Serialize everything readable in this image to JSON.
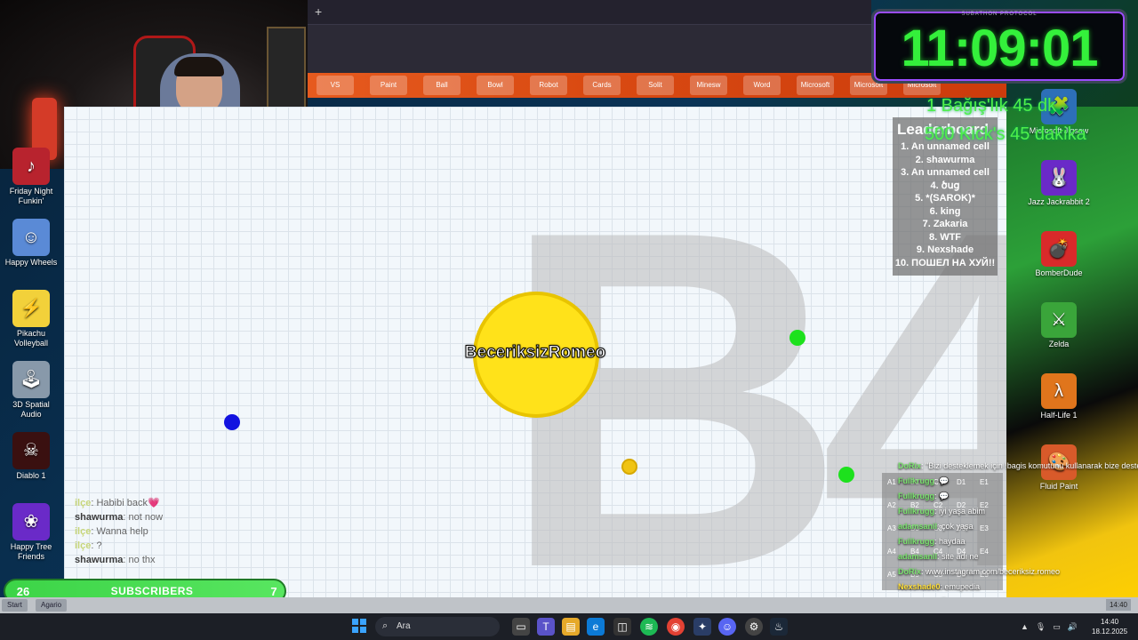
{
  "timer": {
    "header": "SUBATHON PROTOCOL",
    "time": "11:09:01",
    "sub1": "1 Bağış'lık 45 dk",
    "sub2": "500 Kick's 45 dakika"
  },
  "game": {
    "player_name": "BeceriksizRomeo",
    "background_text": "B4",
    "leaderboard": {
      "title": "Leaderboard",
      "entries": [
        "1. An unnamed cell",
        "2. shawurma",
        "3. An unnamed cell",
        "4. ծսց",
        "5. *(SAROK)*",
        "6. king",
        "7. Zakaria",
        "8. WTF",
        "9. Nexshade",
        "10. ПОШЕЛ НА ХУЙ!!"
      ]
    },
    "chat": [
      {
        "nick": "ilçe",
        "msg": ": Habibi back💗",
        "faint": true
      },
      {
        "nick": "shawurma",
        "msg": ": not now",
        "faint": false
      },
      {
        "nick": "ilçe",
        "msg": ": Wanna help",
        "faint": true
      },
      {
        "nick": "ilçe",
        "msg": ": ?",
        "faint": true
      },
      {
        "nick": "shawurma",
        "msg": ": no thx",
        "faint": false
      }
    ]
  },
  "subscribers": {
    "count": "26",
    "label": "SUBSCRIBERS",
    "goal": "7"
  },
  "desktop_icons_left": [
    {
      "label": "Friday Night Funkin'",
      "icon": "fnf-icon"
    },
    {
      "label": "Happy Wheels",
      "icon": "happy-wheels-icon"
    },
    {
      "label": "Pikachu Volleyball",
      "icon": "pikachu-icon"
    },
    {
      "label": "3D Spatial Audio",
      "icon": "joystick-icon"
    },
    {
      "label": "Diablo 1",
      "icon": "diablo-icon"
    },
    {
      "label": "Happy Tree Friends",
      "icon": "htf-icon"
    }
  ],
  "desktop_icons_right": [
    {
      "label": "Microsoft Jigsaw",
      "icon": "jigsaw-icon"
    },
    {
      "label": "Jazz Jackrabbit 2",
      "icon": "jazz-icon"
    },
    {
      "label": "BomberDude",
      "icon": "bomber-icon"
    },
    {
      "label": "Zelda",
      "icon": "zelda-icon"
    },
    {
      "label": "Half-Life 1",
      "icon": "halflife-icon"
    },
    {
      "label": "Fluid Paint",
      "icon": "fluidpaint-icon"
    }
  ],
  "strip_items": [
    "VS",
    "Paint",
    "Ball",
    "Bowl",
    "Robot",
    "Cards",
    "Solit",
    "Minesw",
    "Word",
    "Microsoft",
    "Microsoft",
    "Microsoft"
  ],
  "feed": [
    {
      "user": "DoRix",
      "msg": ": \"Bizi desteklemek için !bagis komutunu kullanarak bize destek verebilirsiniz\""
    },
    {
      "user": "Fullkrugg",
      "msg": ": 💬"
    },
    {
      "user": "Fullkrugg",
      "msg": ": 💬"
    },
    {
      "user": "Fullkrugg",
      "msg": ": iyi yaşa abim"
    },
    {
      "user": "adamsanil",
      "msg": ": çok yaşa"
    },
    {
      "user": "Fullkrugg",
      "msg": ": haydaa"
    },
    {
      "user": "adamsanil",
      "msg": ": site adı ne"
    },
    {
      "user": "DoRix",
      "msg": ": www.instagram.com/beceriksiz.romeo"
    },
    {
      "user": "Nexshade0",
      "msg": ": emupedia",
      "yellow": true
    },
    {
      "user": "Fullkrugg",
      "msg": ": 💬"
    },
    {
      "user": "Fullkrugg",
      "msg": ": 💬"
    }
  ],
  "grid_labels": [
    "A1",
    "B1",
    "C1",
    "D1",
    "E1",
    "A2",
    "B2",
    "C2",
    "D2",
    "E2",
    "A3",
    "B3",
    "C3",
    "D3",
    "E3",
    "A4",
    "B4",
    "C4",
    "D4",
    "E4",
    "A5",
    "B5",
    "C5",
    "D5",
    "E5"
  ],
  "oldbar": {
    "start": "Start",
    "app": "Agario",
    "time": "14:40"
  },
  "taskbar": {
    "search_placeholder": "Ara",
    "clock_time": "14:40",
    "clock_date": "18.12.2025",
    "emuos": "EmuOS v1.0 Beta"
  },
  "browser": {
    "new_tab": "+"
  }
}
